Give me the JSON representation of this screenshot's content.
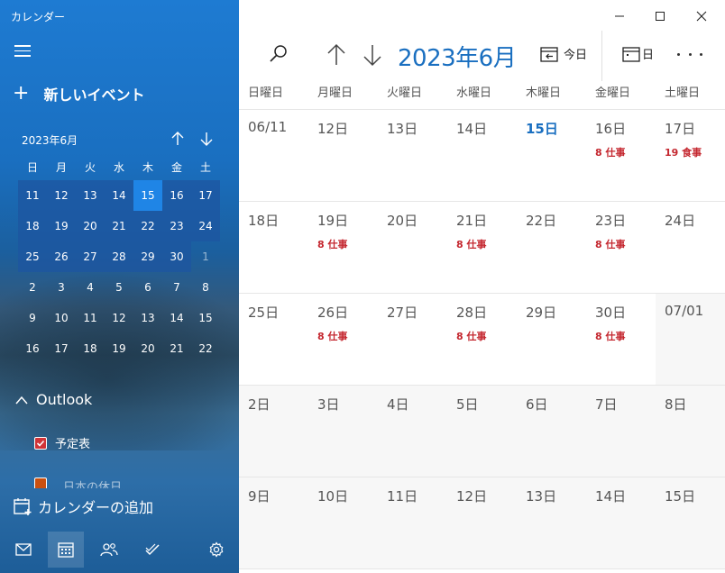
{
  "app": {
    "title": "カレンダー"
  },
  "sidebar": {
    "new_event_label": "新しいイベント",
    "mini_calendar": {
      "title": "2023年6月",
      "weekdays": [
        "日",
        "月",
        "火",
        "水",
        "木",
        "金",
        "土"
      ],
      "weeks": [
        [
          "11",
          "12",
          "13",
          "14",
          "15",
          "16",
          "17"
        ],
        [
          "18",
          "19",
          "20",
          "21",
          "22",
          "23",
          "24"
        ],
        [
          "25",
          "26",
          "27",
          "28",
          "29",
          "30",
          "1"
        ],
        [
          "2",
          "3",
          "4",
          "5",
          "6",
          "7",
          "8"
        ],
        [
          "9",
          "10",
          "11",
          "12",
          "13",
          "14",
          "15"
        ],
        [
          "16",
          "17",
          "18",
          "19",
          "20",
          "21",
          "22"
        ]
      ],
      "today": "15"
    },
    "accounts_header": "Outlook",
    "calendars": [
      {
        "label": "予定表",
        "color": "#d13438",
        "checked": true
      },
      {
        "label": "日本の休日",
        "color": "#ca5010",
        "checked": true
      }
    ],
    "add_calendar_label": "カレンダーの追加"
  },
  "toolbar": {
    "month_title": "2023年6月",
    "today_label": "今日",
    "view_label": "日"
  },
  "weekday_headers": [
    "日曜日",
    "月曜日",
    "火曜日",
    "水曜日",
    "木曜日",
    "金曜日",
    "土曜日"
  ],
  "month_grid": [
    [
      {
        "date": "06/11"
      },
      {
        "date": "12日"
      },
      {
        "date": "13日"
      },
      {
        "date": "14日"
      },
      {
        "date": "15日",
        "today": true
      },
      {
        "date": "16日",
        "event": "8 仕事"
      },
      {
        "date": "17日",
        "event": "19 食事"
      }
    ],
    [
      {
        "date": "18日"
      },
      {
        "date": "19日",
        "event": "8 仕事"
      },
      {
        "date": "20日"
      },
      {
        "date": "21日",
        "event": "8 仕事"
      },
      {
        "date": "22日"
      },
      {
        "date": "23日",
        "event": "8 仕事"
      },
      {
        "date": "24日"
      }
    ],
    [
      {
        "date": "25日"
      },
      {
        "date": "26日",
        "event": "8 仕事"
      },
      {
        "date": "27日"
      },
      {
        "date": "28日",
        "event": "8 仕事"
      },
      {
        "date": "29日"
      },
      {
        "date": "30日",
        "event": "8 仕事"
      },
      {
        "date": "07/01",
        "other": true
      }
    ],
    [
      {
        "date": "2日",
        "other": true
      },
      {
        "date": "3日",
        "other": true
      },
      {
        "date": "4日",
        "other": true
      },
      {
        "date": "5日",
        "other": true
      },
      {
        "date": "6日",
        "other": true
      },
      {
        "date": "7日",
        "other": true
      },
      {
        "date": "8日",
        "other": true
      }
    ],
    [
      {
        "date": "9日",
        "other": true
      },
      {
        "date": "10日",
        "other": true
      },
      {
        "date": "11日",
        "other": true
      },
      {
        "date": "12日",
        "other": true
      },
      {
        "date": "13日",
        "other": true
      },
      {
        "date": "14日",
        "other": true
      },
      {
        "date": "15日",
        "other": true
      }
    ]
  ],
  "colors": {
    "accent": "#1a6fc0",
    "event_text": "#c4262e",
    "today_highlight": "#1f85e6"
  },
  "icons": {
    "hamburger": "hamburger-menu-icon",
    "search": "search-icon",
    "nav_up": "arrow-up-icon",
    "nav_down": "arrow-down-icon",
    "today": "calendar-today-icon",
    "day_view": "calendar-day-icon",
    "more": "more-icon",
    "mail": "mail-icon",
    "calendar": "calendar-icon",
    "people": "people-icon",
    "todo": "todo-check-icon",
    "settings": "gear-icon"
  }
}
